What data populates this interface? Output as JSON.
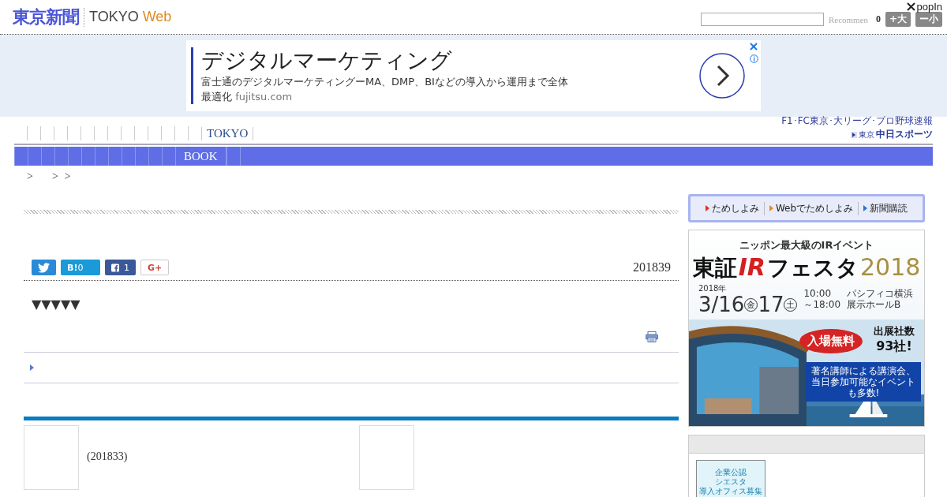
{
  "header": {
    "logo_jp": "東京新聞",
    "logo_en": "TOKYO",
    "logo_web": "Web",
    "recommend": "Recommen",
    "count": "0",
    "font_buttons": [
      {
        "label": "+大"
      },
      {
        "label": "ー小"
      }
    ],
    "popin": "popIn"
  },
  "ad": {
    "headline": "デジタルマーケティング",
    "body": "富士通のデジタルマーケティングーMA、DMP、BIなどの導入から運用まで全体最適化",
    "domain": "fujitsu.com"
  },
  "nav": {
    "top_label": "TOKYO",
    "blue_label": "BOOK",
    "sports_caption": "F1･FC東京･大リーグ･プロ野球速報",
    "sports_logo_small": "東京",
    "sports_logo": "中日スポーツ"
  },
  "breadcrumb": [
    ">",
    ">",
    ">"
  ],
  "article": {
    "share": [
      {
        "kind": "twitter"
      },
      {
        "kind": "hatena",
        "label": "B!",
        "count": "0"
      },
      {
        "kind": "facebook",
        "count": "1"
      },
      {
        "kind": "gplus",
        "label": "G+"
      }
    ],
    "date": "201839",
    "body": "▼▼▼▼▼"
  },
  "related": {
    "caption": "(201833)"
  },
  "sidebar": {
    "links": [
      {
        "label": "ためしよみ",
        "color": "#e03020"
      },
      {
        "label": "Webでためしよみ",
        "color": "#e08a20"
      },
      {
        "label": "新聞購読",
        "color": "#2a70d0"
      }
    ],
    "banner": {
      "tagline": "ニッポン最大級のIRイベント",
      "title_a": "東証",
      "title_ir": "IR",
      "title_b": "フェスタ",
      "year": "2018",
      "date_year": "2018年",
      "day1": "3/16",
      "dow1": "金",
      "day2": "17",
      "dow2": "土",
      "time_start": "10:00",
      "time_end": "～18:00",
      "venue": "パシフィコ横浜",
      "hall": "展示ホールB",
      "free": "入場無料",
      "exhibitors_label": "出展社数",
      "exhibitors": "93社!",
      "note": "著名講師による講演会、当日参加可能なイベントも多数!"
    },
    "promo": {
      "line1": "企業公認",
      "line2": "シエスタ",
      "line3": "導入オフィス募集"
    }
  }
}
